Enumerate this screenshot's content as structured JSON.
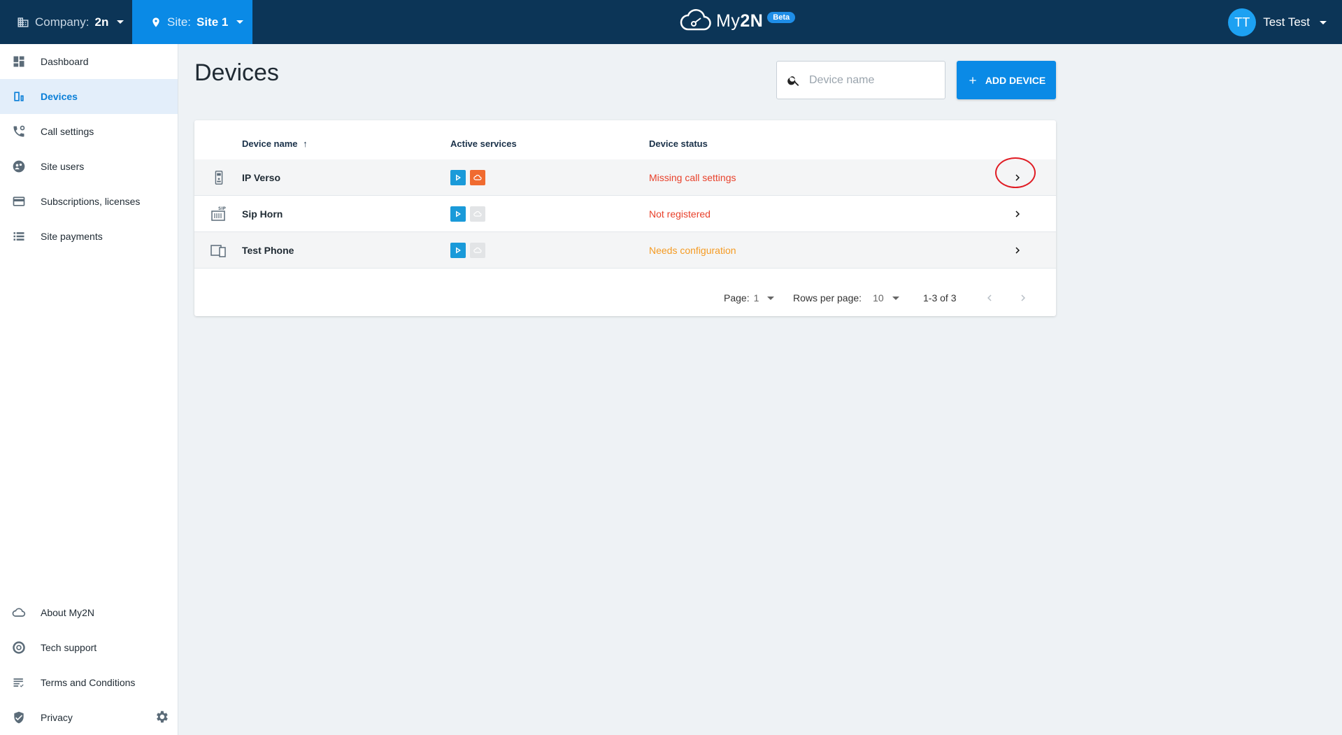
{
  "topbar": {
    "company_label": "Company:",
    "company_value": "2n",
    "site_label": "Site:",
    "site_value": "Site 1",
    "logo_text_a": "My",
    "logo_text_b": "2N",
    "beta": "Beta",
    "avatar_initials": "TT",
    "user_name": "Test Test"
  },
  "sidebar": {
    "items": [
      {
        "label": "Dashboard",
        "icon": "dashboard-icon"
      },
      {
        "label": "Devices",
        "icon": "devices-icon",
        "active": true
      },
      {
        "label": "Call settings",
        "icon": "phone-settings-icon"
      },
      {
        "label": "Site users",
        "icon": "users-icon"
      },
      {
        "label": "Subscriptions, licenses",
        "icon": "card-icon"
      },
      {
        "label": "Site payments",
        "icon": "list-icon"
      }
    ],
    "bottom": [
      {
        "label": "About My2N",
        "icon": "cloud-icon"
      },
      {
        "label": "Tech support",
        "icon": "support-icon"
      },
      {
        "label": "Terms and Conditions",
        "icon": "terms-icon"
      },
      {
        "label": "Privacy",
        "icon": "shield-icon"
      }
    ]
  },
  "page": {
    "title": "Devices",
    "search_placeholder": "Device name",
    "add_button": "ADD DEVICE"
  },
  "table": {
    "headers": {
      "name": "Device name",
      "services": "Active services",
      "status": "Device status"
    },
    "rows": [
      {
        "name": "IP Verso",
        "status": "Missing call settings",
        "status_color": "#e8412b",
        "cloud_active": true
      },
      {
        "name": "Sip Horn",
        "status": "Not registered",
        "status_color": "#e8412b",
        "cloud_active": false
      },
      {
        "name": "Test Phone",
        "status": "Needs configuration",
        "status_color": "#f59b23",
        "cloud_active": false
      }
    ],
    "pager": {
      "page_label": "Page:",
      "page_value": "1",
      "rows_label": "Rows per page:",
      "rows_value": "10",
      "range": "1-3 of 3"
    }
  },
  "colors": {
    "accent": "#0a8ae6",
    "topbar": "#0c3557"
  }
}
